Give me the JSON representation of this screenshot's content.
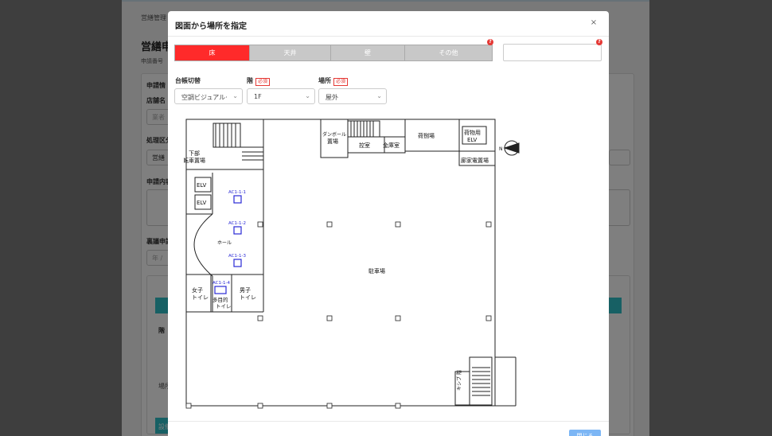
{
  "background": {
    "breadcrumb": "営繕管理",
    "page_title": "営繕申",
    "sub_label": "申請番号",
    "section_title": "申請情",
    "store_label": "店舗名",
    "store_placeholder": "業者",
    "process_label": "処理区分",
    "process_value": "営繕",
    "content_label": "申請内容",
    "date_label": "裏議申請",
    "date_placeholder": "年 /",
    "place_label": "場所",
    "floor_label": "階",
    "equip_label": "設備"
  },
  "modal": {
    "title": "図面から場所を指定",
    "close_icon": "close-icon",
    "tabs": [
      {
        "label": "床",
        "active": true
      },
      {
        "label": "天井",
        "active": false
      },
      {
        "label": "壁",
        "active": false
      },
      {
        "label": "その他",
        "active": false
      }
    ],
    "tab_badge": "?",
    "location_input_value": "",
    "location_badge": "?",
    "fields": {
      "ledger_label": "台帳切替",
      "ledger_value": "空調ビジュアル·",
      "floor_label": "階",
      "floor_value": "1F",
      "place_label": "場所",
      "place_value": "屋外",
      "required": "必須"
    },
    "footer_button": "閉じる"
  },
  "floorplan": {
    "labels": {
      "bike_parking": [
        "下部",
        "自転車置場"
      ],
      "cardboard": [
        "ダンボール",
        "置場"
      ],
      "break_room": "控室",
      "safe_room": "金庫室",
      "loading": "荷捌場",
      "freight_elv": [
        "荷物用",
        "ELV"
      ],
      "utility": "廊家電置場",
      "elv1": "ELV",
      "elv2": "ELV",
      "hall": "ホール",
      "women": [
        "女子",
        "トイレ"
      ],
      "men": [
        "男子",
        "トイレ"
      ],
      "multi": [
        "多目的",
        "トイレ"
      ],
      "parking": "駐車場",
      "stairs": "キシブ 階",
      "north": "N"
    },
    "units": [
      "AC1-1-1",
      "AC1-1-2",
      "AC1-1-3",
      "AC1-1-4"
    ]
  }
}
